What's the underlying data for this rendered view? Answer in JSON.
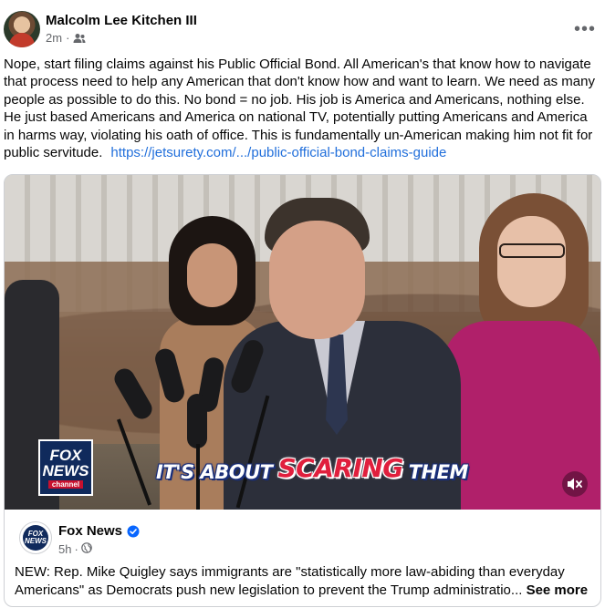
{
  "post": {
    "author": "Malcolm Lee Kitchen III",
    "time": "2m",
    "audience_icon": "friends-icon",
    "more_label": "•••",
    "body": "Nope, start filing claims against his Public Official Bond. All American's that know how to navigate that process need to help any American that don't know how and want to learn. We need as many people as possible to do this. No bond = no job. His job is America and Americans, nothing else. He just based Americans and America on national TV, potentially putting Americans and America in harms way, violating his oath of office. This is fundamentally un-American making him not fit for public servitude.",
    "link_text": "https://jetsurety.com/.../public-official-bond-claims-guide"
  },
  "shared": {
    "video": {
      "logo_line1": "FOX",
      "logo_line2": "NEWS",
      "logo_line3": "channel",
      "caption_part1": "IT'S ABOUT",
      "caption_part2": "SCARING",
      "caption_part3": "THEM",
      "mute_icon": "speaker-muted-icon"
    },
    "source_name": "Fox News",
    "source_avatar_line1": "FOX",
    "source_avatar_line2": "NEWS",
    "verified_icon": "verified-badge-icon",
    "time": "5h",
    "globe_icon": "globe-icon",
    "text": "NEW: Rep. Mike Quigley says immigrants are \"statistically more law-abiding than everyday Americans\" as Democrats push new legislation to prevent the Trump administratio...",
    "see_more": "See more"
  },
  "colors": {
    "link": "#216fdb",
    "secondary_text": "#65676b",
    "verified": "#0866ff",
    "fox_red": "#e01f3d",
    "fox_blue": "#102a5c"
  }
}
